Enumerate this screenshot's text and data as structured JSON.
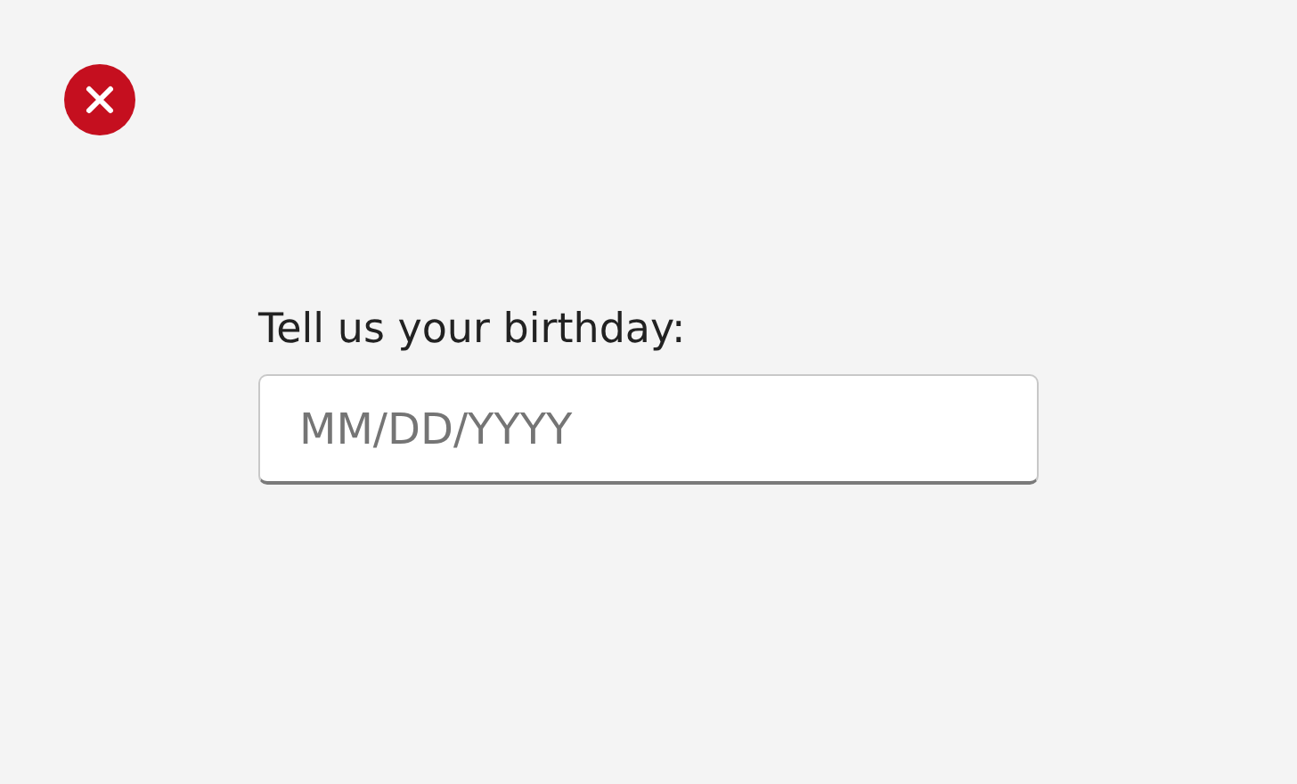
{
  "error_icon": {
    "kind": "error"
  },
  "field": {
    "label": "Tell us your birthday:",
    "placeholder": "MM/DD/YYYY"
  }
}
